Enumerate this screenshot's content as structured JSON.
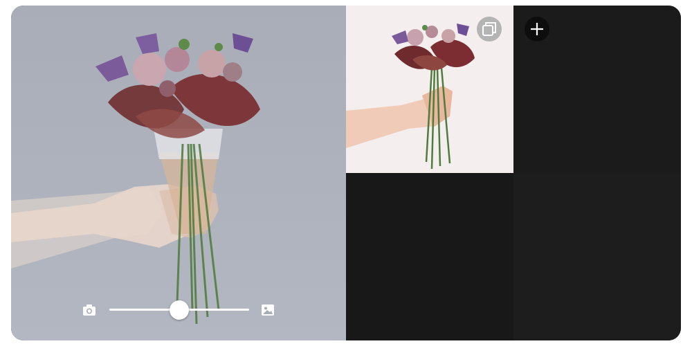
{
  "app": {
    "background": "#1a1a1a",
    "accent": "#ffffff"
  },
  "preview": {
    "overlay_opacity": 0.5,
    "left_icon": "camera-icon",
    "right_icon": "image-icon"
  },
  "grid": {
    "cells": [
      {
        "content": "bouquet-photo",
        "button_icon": "layers-icon"
      },
      {
        "content": "empty",
        "button_icon": "add-icon"
      },
      {
        "content": "empty"
      },
      {
        "content": "empty"
      }
    ]
  }
}
